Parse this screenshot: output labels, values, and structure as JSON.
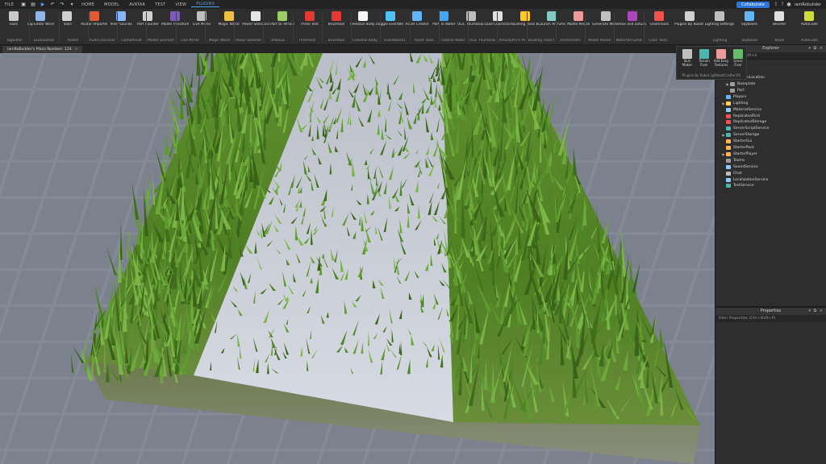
{
  "menubar": {
    "items": [
      "FILE",
      "HOME",
      "MODEL",
      "AVATAR",
      "TEST",
      "VIEW",
      "PLUGINS"
    ],
    "active": "PLUGINS",
    "collaborate_label": "Collaborate",
    "username": "iamRobuilder"
  },
  "ribbon": {
    "tools": [
      {
        "label": "Tools",
        "icon": "tools-icon",
        "color": "#c9c9c9"
      },
      {
        "label": "Tag Editor Window",
        "icon": "tag-icon",
        "color": "#8fb6e8"
      },
      {
        "label": "Tools",
        "icon": "wrench-icon",
        "color": "#d0d0d0"
      },
      {
        "label": "Avatar Importer",
        "icon": "avatar-icon",
        "color": "#e05a3a"
      },
      {
        "label": "View Sounds",
        "icon": "speaker-icon",
        "color": "#8ab4f8"
      },
      {
        "label": "Part Counter",
        "icon": "cube-icon",
        "color": "#d0d0d0"
      },
      {
        "label": "Model Transform",
        "icon": "transform-icon",
        "color": "#7e57c2"
      },
      {
        "label": "Live Mirror",
        "icon": "mirror-icon",
        "color": "#c0c0c0"
      },
      {
        "label": "Magic Wand",
        "icon": "wand-icon",
        "color": "#f0c040"
      },
      {
        "label": "Power Selectors",
        "icon": "sphere-icon",
        "color": "#e6e6e6"
      },
      {
        "label": "Part to Terrain",
        "icon": "terrain-icon",
        "color": "#9ccc65"
      },
      {
        "label": "Three Text",
        "icon": "3d-text-icon",
        "color": "#e53935"
      },
      {
        "label": "Brushtool",
        "icon": "brush-icon",
        "color": "#e53935"
      },
      {
        "label": "Celestial Body Dragger",
        "icon": "moon-icon",
        "color": "#f5f5f5"
      },
      {
        "label": "Toggle EventBlocks",
        "icon": "toggle-icon",
        "color": "#4fc3f7"
      },
      {
        "label": "Asset Creator",
        "icon": "asset-icon",
        "color": "#64b5f6"
      },
      {
        "label": "Part To Water",
        "icon": "water-icon",
        "color": "#42a5f5"
      },
      {
        "label": "UGC Thumbnail Tool",
        "icon": "thumbnail-icon",
        "color": "#bdbdbd"
      },
      {
        "label": "Load Character Pro",
        "icon": "character-icon",
        "color": "#e0e0e0"
      },
      {
        "label": "Building Tools by F3X",
        "icon": "f3x-icon",
        "color": "#ffca28"
      },
      {
        "label": "Launch Archimedes",
        "icon": "archimedes-icon",
        "color": "#80cbc4"
      },
      {
        "label": "Model Resize",
        "icon": "resize-icon",
        "color": "#ef9a9a"
      },
      {
        "label": "Generate Waterfall",
        "icon": "waterfall-icon",
        "color": "#c0c0c0"
      },
      {
        "label": "Hue and Saturation",
        "icon": "color-wheel-icon",
        "color": "#ab47bc"
      },
      {
        "label": "GeomTools",
        "icon": "geom-icon",
        "color": "#ef5350"
      }
    ],
    "groups": [
      "TagEditor",
      "Localization",
      "Avatar",
      "Audio Discovery",
      "GameAssist",
      "Model Geometry",
      "Live Mirror",
      "Magic Wand",
      "Power Selectors",
      "imbaGui",
      "ThreeText",
      "Brushtool",
      "Celestial Body Dragger",
      "EventBlocks",
      "Asset Tools",
      "Outline Water",
      "UGC Thumbnail Tool",
      "AlreadyPro's Plugins",
      "Building Tools by F3X",
      "Archimedes",
      "Model Resize",
      "Waterfall Generator",
      "Color Tools"
    ],
    "right_tools": [
      {
        "label": "Plugins By Robot (@RobotCrafter1P)",
        "icon": "plugins-by-icon",
        "color": "#d0d0d0"
      },
      {
        "label": "Lighting Settings",
        "icon": "lighting-icon",
        "color": "#c0c0c0"
      },
      {
        "label": "Skyboxes",
        "icon": "cloud-icon",
        "color": "#64b5f6"
      },
      {
        "label": "Beveler",
        "icon": "beveler-icon",
        "color": "#e0e0e0"
      },
      {
        "label": "AutoCode",
        "icon": "code-icon",
        "color": "#cddc39"
      }
    ],
    "right_groups": [
      "Lighting",
      "Skyboxes",
      "Bevel",
      "AutoCode"
    ]
  },
  "plugin_popup": {
    "items": [
      {
        "label": "Skin Maker",
        "color": "#c0c0c0"
      },
      {
        "label": "Terrain Fixer",
        "color": "#4db6ac"
      },
      {
        "label": "Add Easy Textures",
        "color": "#ef9a9a"
      },
      {
        "label": "Grass Fixer",
        "color": "#66bb6a"
      }
    ],
    "footer": "Plugins By Robot (@RobotCrafter1P)"
  },
  "placetab": {
    "label": "iamRoBuilder's Place Number: 124"
  },
  "explorer": {
    "title": "Explorer",
    "filter": "Ctrl+Shift+X",
    "rows": [
      {
        "label": "e",
        "indent": 2,
        "arrow": "",
        "color": "#888888"
      },
      {
        "label": "era",
        "indent": 2,
        "arrow": "",
        "color": "#888888"
      },
      {
        "label": "in",
        "indent": 2,
        "arrow": "",
        "color": "#888888"
      },
      {
        "label": "SpawnLocation",
        "indent": 2,
        "arrow": "▶",
        "color": "#9e9e9e"
      },
      {
        "label": "Baseplate",
        "indent": 2,
        "arrow": "▶",
        "color": "#9e9e9e"
      },
      {
        "label": "Part",
        "indent": 2,
        "arrow": "",
        "color": "#9e9e9e"
      },
      {
        "label": "Players",
        "indent": 1,
        "arrow": "",
        "color": "#64b5f6"
      },
      {
        "label": "Lighting",
        "indent": 1,
        "arrow": "▶",
        "color": "#ffd54f"
      },
      {
        "label": "MaterialService",
        "indent": 1,
        "arrow": "",
        "color": "#90caf9"
      },
      {
        "label": "ReplicatedFirst",
        "indent": 1,
        "arrow": "",
        "color": "#ef5350"
      },
      {
        "label": "ReplicatedStorage",
        "indent": 1,
        "arrow": "",
        "color": "#ef5350"
      },
      {
        "label": "ServerScriptService",
        "indent": 1,
        "arrow": "",
        "color": "#4db6ac"
      },
      {
        "label": "ServerStorage",
        "indent": 1,
        "arrow": "▶",
        "color": "#4db6ac"
      },
      {
        "label": "StarterGui",
        "indent": 1,
        "arrow": "",
        "color": "#ffb74d"
      },
      {
        "label": "StarterPack",
        "indent": 1,
        "arrow": "",
        "color": "#ffb74d"
      },
      {
        "label": "StarterPlayer",
        "indent": 1,
        "arrow": "▶",
        "color": "#ffb74d"
      },
      {
        "label": "Teams",
        "indent": 1,
        "arrow": "",
        "color": "#9e9e9e"
      },
      {
        "label": "SoundService",
        "indent": 1,
        "arrow": "",
        "color": "#90caf9"
      },
      {
        "label": "Chat",
        "indent": 1,
        "arrow": "",
        "color": "#bdbdbd"
      },
      {
        "label": "LocalizationService",
        "indent": 1,
        "arrow": "",
        "color": "#90caf9"
      },
      {
        "label": "TestService",
        "indent": 1,
        "arrow": "",
        "color": "#4db6ac"
      }
    ]
  },
  "properties": {
    "title": "Properties",
    "filter": "Filter Properties (Ctrl+Shift+P)"
  }
}
